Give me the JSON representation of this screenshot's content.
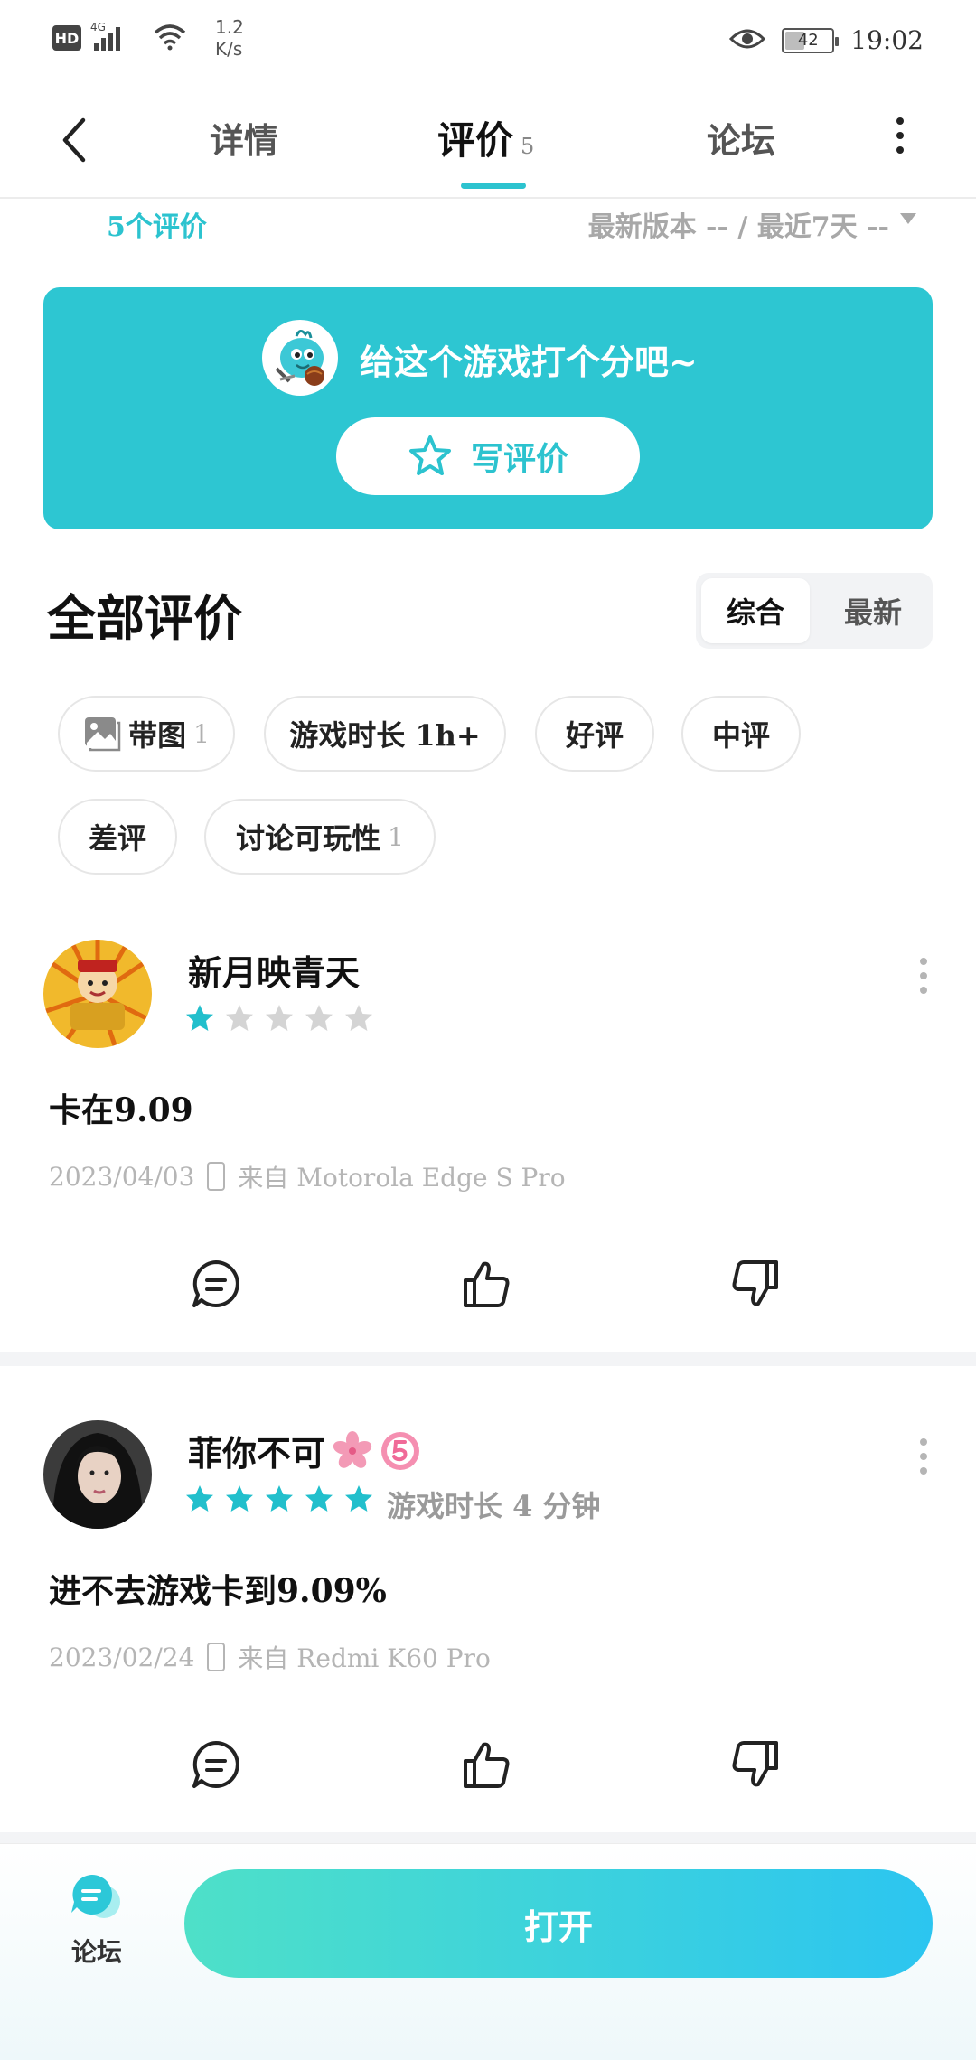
{
  "status_bar": {
    "hd": "HD",
    "signal": "4G",
    "net_speed_value": "1.2",
    "net_speed_unit": "K/s",
    "battery": "42",
    "battery_level": 0.42,
    "time": "19:02"
  },
  "nav": {
    "tabs": [
      {
        "label": "详情"
      },
      {
        "label": "评价",
        "count": "5"
      },
      {
        "label": "论坛"
      }
    ],
    "active_tab": "评价"
  },
  "summary": {
    "review_count": "5个评价",
    "version_filter": "最新版本 -- / 最近7天 --"
  },
  "rate_card": {
    "title": "给这个游戏打个分吧~",
    "write_button": "写评价"
  },
  "all_reviews": {
    "title": "全部评价",
    "sort_options": [
      "综合",
      "最新"
    ],
    "active_sort": "综合"
  },
  "chips": [
    {
      "label": "带图",
      "count": "1"
    },
    {
      "label": "游戏时长 1h+",
      "count": ""
    },
    {
      "label": "好评",
      "count": ""
    },
    {
      "label": "中评",
      "count": ""
    },
    {
      "label": "差评",
      "count": ""
    },
    {
      "label": "讨论可玩性",
      "count": "1"
    }
  ],
  "reviews": [
    {
      "name": "新月映青天",
      "rating": 1,
      "max_rating": 5,
      "play_time": "",
      "content": "卡在9.09",
      "date": "2023/04/03",
      "device": "来自 Motorola Edge S Pro"
    },
    {
      "name": "菲你不可",
      "rating": 5,
      "max_rating": 5,
      "play_time": "游戏时长 4 分钟",
      "content": "进不去游戏卡到9.09%",
      "date": "2023/02/24",
      "device": "来自 Redmi K60 Pro"
    }
  ],
  "bottom_bar": {
    "forum_label": "论坛",
    "open_button": "打开"
  },
  "colors": {
    "accent": "#2cc3cf",
    "star_on": "#22bfcc",
    "star_off": "#d4d4d4"
  }
}
